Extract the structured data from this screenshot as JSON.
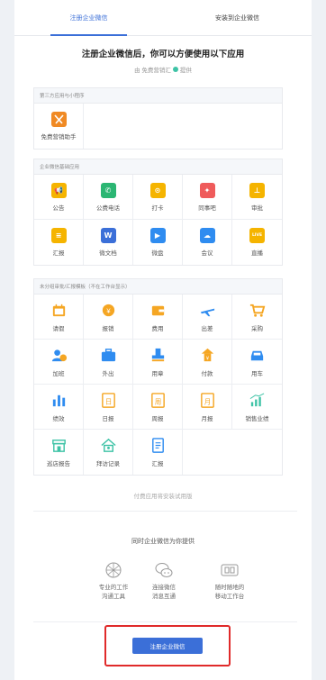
{
  "tabs": [
    {
      "label": "注册企业微信"
    },
    {
      "label": "安装到企业微信"
    }
  ],
  "header": {
    "headline": "注册企业微信后，你可以方便使用以下应用",
    "provider": "由 免费营销汇",
    "provider_suffix": "提供"
  },
  "third_party": {
    "title": "第三方应用与小程序",
    "items": [
      {
        "label": "免费营销助手",
        "icon": "marketing-logo-icon",
        "color": "#f08a24"
      }
    ]
  },
  "basic": {
    "title": "企业微信基础应用",
    "items": [
      {
        "label": "公告",
        "icon": "megaphone-icon",
        "color": "#f5b400",
        "glyph": "📢"
      },
      {
        "label": "公费电话",
        "icon": "phone-icon",
        "color": "#2bb673",
        "glyph": "✆"
      },
      {
        "label": "打卡",
        "icon": "location-pin-icon",
        "color": "#f5b400",
        "glyph": "⊙"
      },
      {
        "label": "同事吧",
        "icon": "diamond-icon",
        "color": "#ef5b5b",
        "glyph": "✦"
      },
      {
        "label": "审批",
        "icon": "stamp-icon",
        "color": "#f5b400",
        "glyph": "⊥"
      },
      {
        "label": "汇报",
        "icon": "report-icon",
        "color": "#f5b400",
        "glyph": "≡"
      },
      {
        "label": "微文档",
        "icon": "doc-w-icon",
        "color": "#3b6fd8",
        "glyph": "W"
      },
      {
        "label": "微盘",
        "icon": "drive-icon",
        "color": "#2f8cf0",
        "glyph": "▶"
      },
      {
        "label": "会议",
        "icon": "cloud-icon",
        "color": "#2f8cf0",
        "glyph": "☁"
      },
      {
        "label": "直播",
        "icon": "live-icon",
        "color": "#f5b400",
        "glyph": "LIVE"
      }
    ]
  },
  "templates": {
    "title": "未分组审批/汇报模板（不在工作台显示）",
    "items": [
      {
        "label": "请假",
        "icon": "calendar-icon",
        "color": "#f5a623"
      },
      {
        "label": "报销",
        "icon": "coin-icon",
        "color": "#f5a623"
      },
      {
        "label": "费用",
        "icon": "wallet-icon",
        "color": "#f5a623"
      },
      {
        "label": "出差",
        "icon": "airplane-icon",
        "color": "#2f8cf0"
      },
      {
        "label": "采购",
        "icon": "cart-icon",
        "color": "#f5a623"
      },
      {
        "label": "加班",
        "icon": "overtime-icon",
        "color": "#2f8cf0"
      },
      {
        "label": "外出",
        "icon": "briefcase-icon",
        "color": "#2f8cf0"
      },
      {
        "label": "用章",
        "icon": "seal-icon",
        "color": "#2f8cf0"
      },
      {
        "label": "付款",
        "icon": "payment-icon",
        "color": "#f5a623"
      },
      {
        "label": "用车",
        "icon": "car-icon",
        "color": "#2f8cf0"
      },
      {
        "label": "绩效",
        "icon": "bar-chart-icon",
        "color": "#2f8cf0"
      },
      {
        "label": "日报",
        "icon": "daily-report-icon",
        "color": "#f5a623",
        "glyph": "日"
      },
      {
        "label": "周报",
        "icon": "weekly-report-icon",
        "color": "#f5a623",
        "glyph": "周"
      },
      {
        "label": "月报",
        "icon": "monthly-report-icon",
        "color": "#f5a623",
        "glyph": "月"
      },
      {
        "label": "销售业绩",
        "icon": "sales-chart-icon",
        "color": "#3ec3a6"
      },
      {
        "label": "巡店报告",
        "icon": "store-icon",
        "color": "#3ec3a6"
      },
      {
        "label": "拜访记录",
        "icon": "visit-home-icon",
        "color": "#3ec3a6"
      },
      {
        "label": "汇报",
        "icon": "document-icon",
        "color": "#2f8cf0"
      }
    ]
  },
  "footnote": "付费应用将安装试用版",
  "promo": {
    "title": "同时企业微信为你提供",
    "features": [
      {
        "line1": "专业的工作",
        "line2": "沟通工具",
        "icon": "network-globe-icon"
      },
      {
        "line1": "连接微信",
        "line2": "消息互通",
        "icon": "chat-bubbles-icon"
      },
      {
        "line1": "随时随地的",
        "line2": "移动工作台",
        "icon": "tablet-icon"
      }
    ]
  },
  "cta": {
    "label": "注册企业微信"
  }
}
